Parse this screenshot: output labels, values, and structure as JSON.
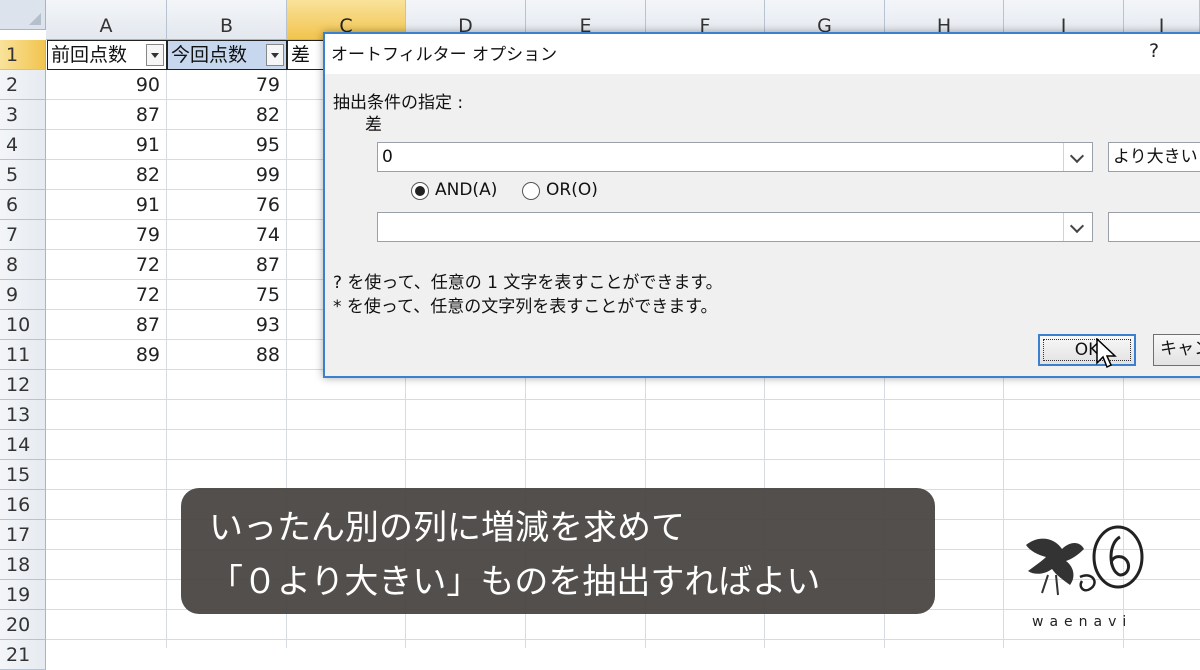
{
  "columns": [
    "A",
    "B",
    "C",
    "D",
    "E",
    "F",
    "G",
    "H",
    "I",
    "J"
  ],
  "rows": [
    "1",
    "2",
    "3",
    "4",
    "5",
    "6",
    "7",
    "8",
    "9",
    "10",
    "11",
    "12",
    "13",
    "14",
    "15",
    "16",
    "17",
    "18",
    "19",
    "20",
    "21"
  ],
  "headers": {
    "a": "前回点数",
    "b": "今回点数",
    "c": "差"
  },
  "data": {
    "a": [
      "90",
      "87",
      "91",
      "82",
      "91",
      "79",
      "72",
      "72",
      "87",
      "89"
    ],
    "b": [
      "79",
      "82",
      "95",
      "99",
      "76",
      "74",
      "87",
      "75",
      "93",
      "88"
    ]
  },
  "dialog": {
    "title": "オートフィルター オプション",
    "help": "?",
    "criteria_label": "抽出条件の指定 :",
    "field_name": "差",
    "value1": "0",
    "operator1": "より大きい",
    "value2": "",
    "operator2": "",
    "and_label": "AND(A)",
    "or_label": "OR(O)",
    "hint1": "? を使って、任意の 1 文字を表すことができます。",
    "hint2": "* を使って、任意の文字列を表すことができます。",
    "ok_label": "OK",
    "cancel_label": "キャン"
  },
  "caption": {
    "line1": "いったん別の列に増減を求めて",
    "line2": "「０より大きい」ものを抽出すればよい"
  },
  "logo": {
    "text": "waenavi"
  },
  "colors": {
    "dialog_border": "#3a7fd0",
    "selected_header": "#f2c44e",
    "caption_bg": "#46423e"
  }
}
